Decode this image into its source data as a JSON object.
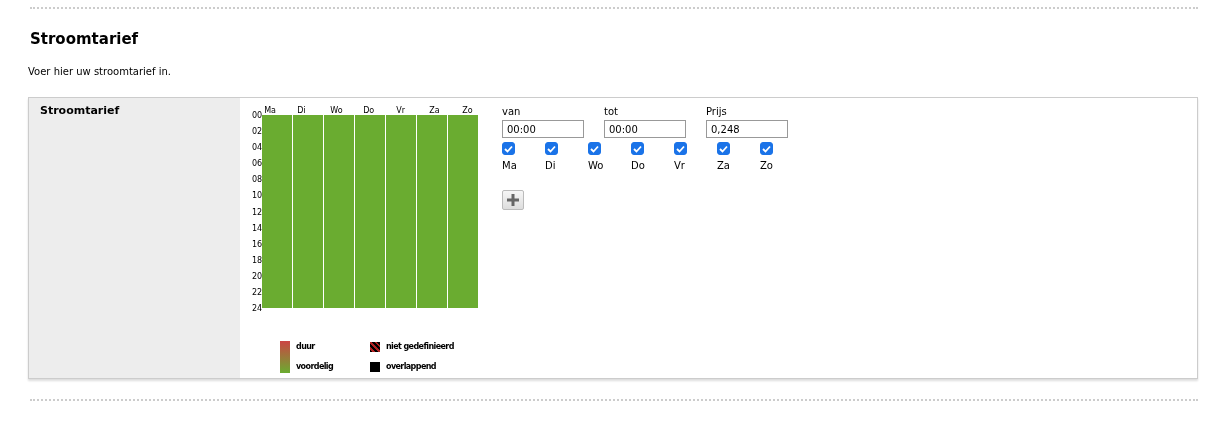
{
  "heading": "Stroomtarief",
  "intro": "Voer hier uw stroomtarief in.",
  "panel": {
    "label": "Stroomtarief",
    "schedule": {
      "days": [
        "Ma",
        "Di",
        "Wo",
        "Do",
        "Vr",
        "Za",
        "Zo"
      ],
      "hours": [
        "00",
        "02",
        "04",
        "06",
        "08",
        "10",
        "12",
        "14",
        "16",
        "18",
        "20",
        "22",
        "24"
      ]
    },
    "legend": {
      "gradient": {
        "high": "duur",
        "low": "voordelig"
      },
      "swatches": [
        {
          "kind": "hatched",
          "label": "niet gedefinieerd"
        },
        {
          "kind": "solid",
          "label": "overlappend"
        }
      ]
    },
    "rates": [
      {
        "from_label": "van",
        "from": "00:00",
        "to_label": "tot",
        "to": "00:00",
        "price_label": "Prijs",
        "price": "0,248",
        "days": [
          {
            "label": "Ma",
            "checked": true
          },
          {
            "label": "Di",
            "checked": true
          },
          {
            "label": "Wo",
            "checked": true
          },
          {
            "label": "Do",
            "checked": true
          },
          {
            "label": "Vr",
            "checked": true
          },
          {
            "label": "Za",
            "checked": true
          },
          {
            "label": "Zo",
            "checked": true
          }
        ]
      }
    ]
  }
}
